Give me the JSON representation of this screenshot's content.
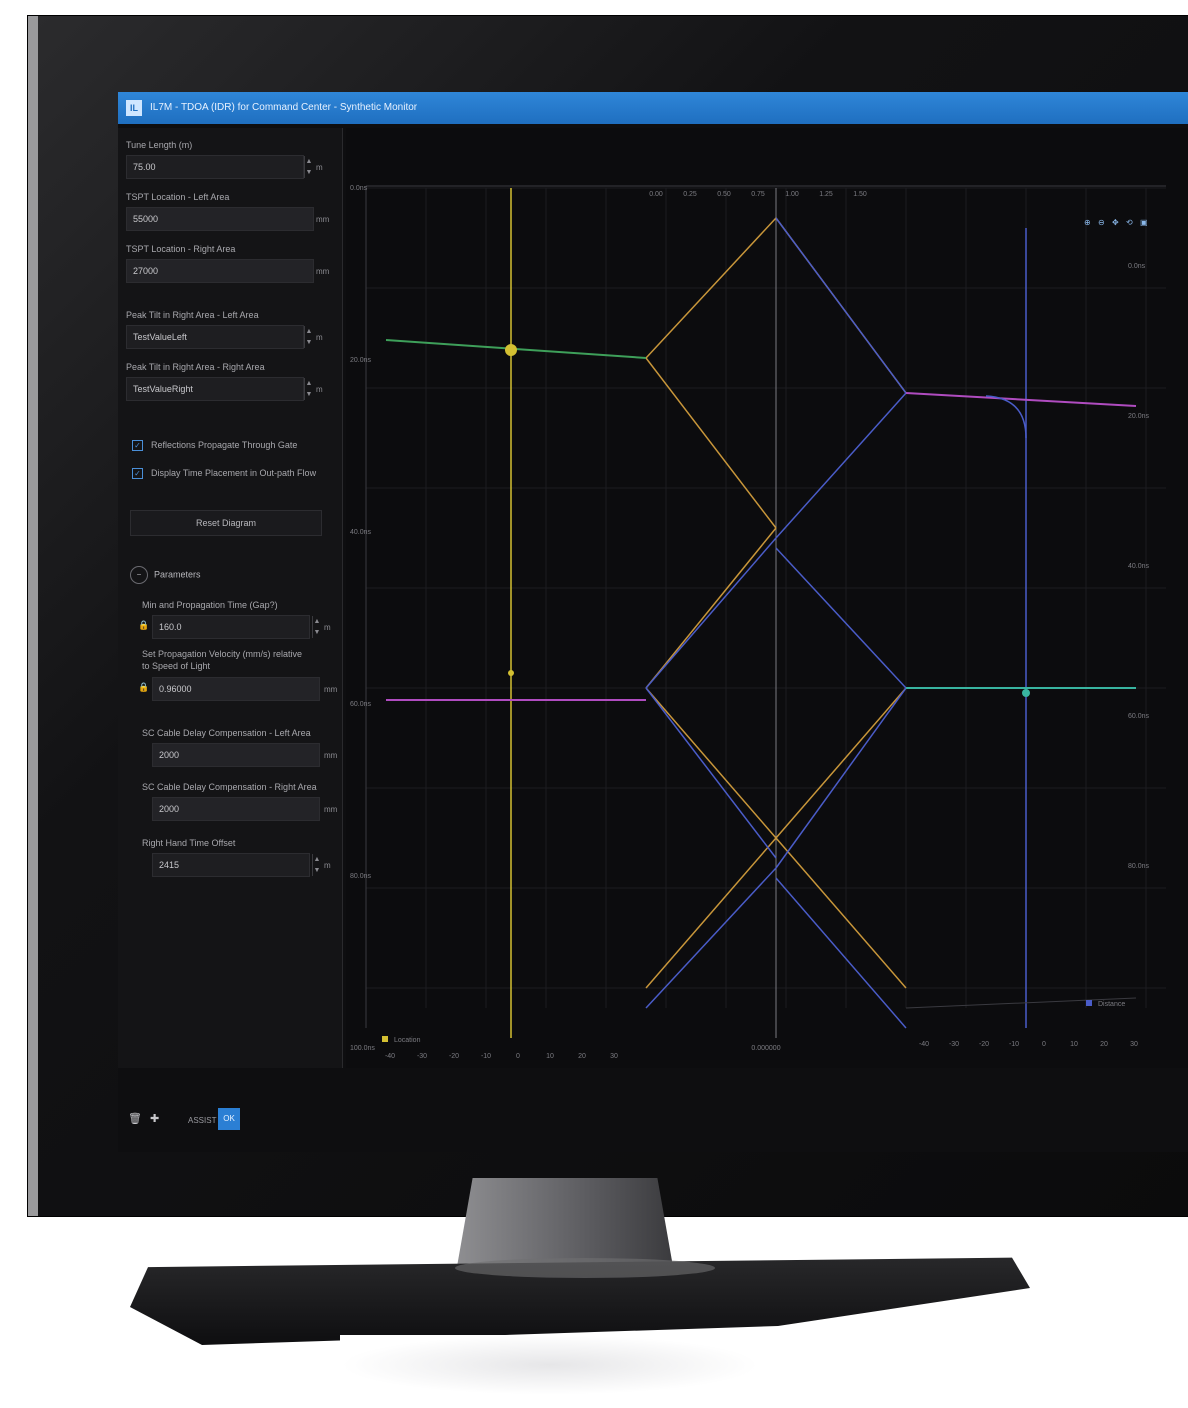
{
  "window": {
    "title": "IL7M - TDOA (IDR) for Command Center - Synthetic Monitor",
    "logo_text": "IL"
  },
  "left_panel": {
    "fields": [
      {
        "label": "Tune Length (m)",
        "value": "75.00",
        "unit": "m",
        "spin": true
      },
      {
        "label": "TSPT Location - Left Area",
        "value": "55000",
        "unit": "mm",
        "spin": false
      },
      {
        "label": "TSPT Location - Right Area",
        "value": "27000",
        "unit": "mm",
        "spin": false
      },
      {
        "label": "Peak Tilt in Right Area - Left Area",
        "value": "TestValueLeft",
        "unit": "m",
        "spin": true
      },
      {
        "label": "Peak Tilt in Right Area - Right Area",
        "value": "TestValueRight",
        "unit": "m",
        "spin": true
      }
    ],
    "checkboxes": [
      {
        "label": "Reflections Propagate Through Gate",
        "checked": true
      },
      {
        "label": "Display Time Placement in Out-path Flow",
        "checked": true
      }
    ],
    "reset_label": "Reset Diagram",
    "parameters_label": "Parameters",
    "param_fields": [
      {
        "label": "Min and Propagation Time (Gap?)",
        "value": "160.0",
        "unit": "m",
        "locked": true,
        "spin": true
      },
      {
        "label": "Set Propagation Velocity (mm/s) relative to Speed of Light",
        "value": "0.96000",
        "unit": "mm",
        "locked": true,
        "spin": false
      },
      {
        "label": "SC Cable Delay Compensation - Left Area",
        "value": "2000",
        "unit": "mm",
        "locked": false,
        "spin": false
      },
      {
        "label": "SC Cable Delay Compensation - Right Area",
        "value": "2000",
        "unit": "mm",
        "locked": false,
        "spin": false
      },
      {
        "label": "Right Hand Time Offset",
        "value": "2415",
        "unit": "m",
        "locked": false,
        "spin": true
      }
    ]
  },
  "plot": {
    "top_ticks": [
      "0.00",
      "0.25",
      "0.50",
      "0.75",
      "1.00",
      "1.25",
      "1.50"
    ],
    "left_ticks": [
      "0.0ns",
      "20.0ns",
      "40.0ns",
      "60.0ns",
      "80.0ns",
      "100.0ns"
    ],
    "right_ticks": [
      "0.0ns",
      "20.0ns",
      "40.0ns",
      "60.0ns",
      "80.0ns"
    ],
    "bottom_left_ticks": [
      "-40",
      "-30",
      "-20",
      "-10",
      "0",
      "10",
      "20",
      "30"
    ],
    "bottom_right_ticks": [
      "-40",
      "-30",
      "-20",
      "-10",
      "0",
      "10",
      "20",
      "30"
    ],
    "center_label": "0.000000",
    "legend_left": "Location",
    "legend_right": "Distance",
    "colors": {
      "yellow": "#d4c032",
      "orange": "#c8963a",
      "blue": "#4a5cc8",
      "green": "#3ea05a",
      "purple": "#b04cc0",
      "teal": "#38b4a0",
      "accent": "#1f6fc0"
    }
  },
  "taskbar": {
    "label": "ASSIST",
    "active_label": "OK"
  }
}
